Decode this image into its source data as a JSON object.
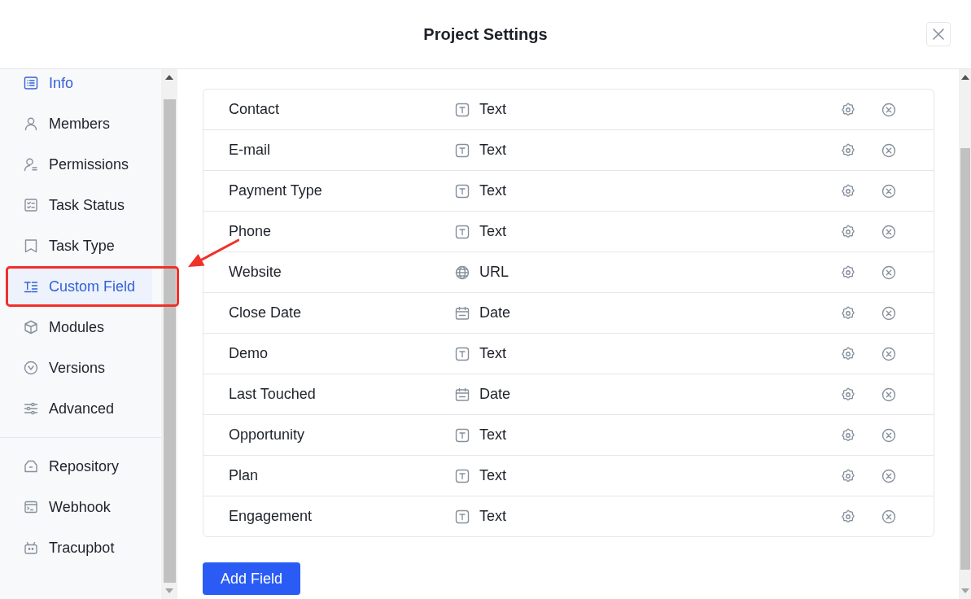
{
  "dialog": {
    "title": "Project Settings"
  },
  "sidebar": {
    "groups": [
      {
        "items": [
          {
            "label": "Info",
            "selected": false,
            "highlighted": true,
            "annotated": false
          },
          {
            "label": "Members",
            "selected": false,
            "highlighted": false,
            "annotated": false
          },
          {
            "label": "Permissions",
            "selected": false,
            "highlighted": false,
            "annotated": false
          },
          {
            "label": "Task Status",
            "selected": false,
            "highlighted": false,
            "annotated": false
          },
          {
            "label": "Task Type",
            "selected": false,
            "highlighted": false,
            "annotated": false
          },
          {
            "label": "Custom Field",
            "selected": true,
            "highlighted": false,
            "annotated": true
          },
          {
            "label": "Modules",
            "selected": false,
            "highlighted": false,
            "annotated": false
          },
          {
            "label": "Versions",
            "selected": false,
            "highlighted": false,
            "annotated": false
          },
          {
            "label": "Advanced",
            "selected": false,
            "highlighted": false,
            "annotated": false
          }
        ]
      },
      {
        "items": [
          {
            "label": "Repository",
            "selected": false,
            "highlighted": false,
            "annotated": false
          },
          {
            "label": "Webhook",
            "selected": false,
            "highlighted": false,
            "annotated": false
          },
          {
            "label": "Tracupbot",
            "selected": false,
            "highlighted": false,
            "annotated": false
          }
        ]
      }
    ]
  },
  "fields": {
    "rows": [
      {
        "name": "Contact",
        "kind": "text",
        "type": "Text"
      },
      {
        "name": "E-mail",
        "kind": "text",
        "type": "Text"
      },
      {
        "name": "Payment Type",
        "kind": "text",
        "type": "Text"
      },
      {
        "name": "Phone",
        "kind": "text",
        "type": "Text"
      },
      {
        "name": "Website",
        "kind": "url",
        "type": "URL"
      },
      {
        "name": "Close Date",
        "kind": "date",
        "type": "Date"
      },
      {
        "name": "Demo",
        "kind": "text",
        "type": "Text"
      },
      {
        "name": "Last Touched",
        "kind": "date",
        "type": "Date"
      },
      {
        "name": "Opportunity",
        "kind": "text",
        "type": "Text"
      },
      {
        "name": "Plan",
        "kind": "text",
        "type": "Text"
      },
      {
        "name": "Engagement",
        "kind": "text",
        "type": "Text"
      }
    ]
  },
  "add_button": "Add Field"
}
